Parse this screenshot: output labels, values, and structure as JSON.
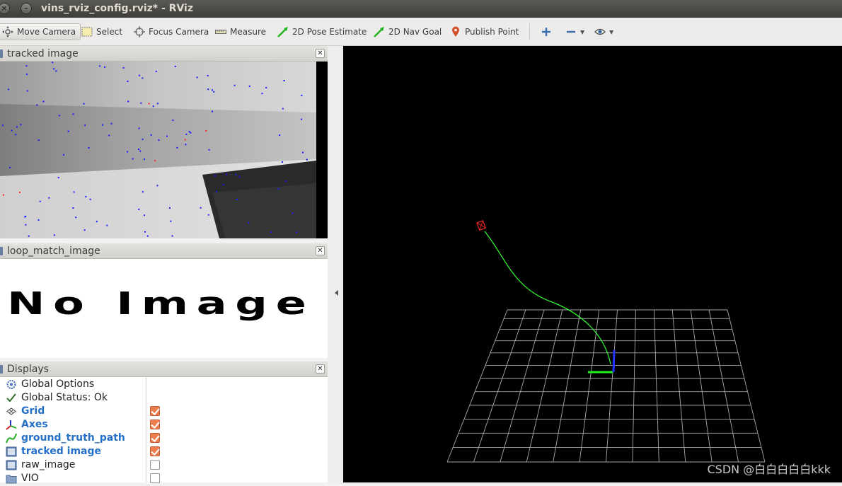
{
  "window": {
    "title": "vins_rviz_config.rviz* - RViz"
  },
  "toolbar": {
    "tools": [
      {
        "label": "Move Camera",
        "icon": "move-camera-icon"
      },
      {
        "label": "Select",
        "icon": "select-icon"
      },
      {
        "label": "Focus Camera",
        "icon": "focus-camera-icon"
      },
      {
        "label": "Measure",
        "icon": "measure-icon"
      },
      {
        "label": "2D Pose Estimate",
        "icon": "pose-estimate-icon"
      },
      {
        "label": "2D Nav Goal",
        "icon": "nav-goal-icon"
      },
      {
        "label": "Publish Point",
        "icon": "publish-point-icon"
      }
    ],
    "active_tool": "Move Camera"
  },
  "panels": {
    "tracked_image": {
      "title": "tracked image"
    },
    "loop_match_image": {
      "title": "loop_match_image",
      "placeholder_text": "No Image"
    },
    "displays": {
      "title": "Displays",
      "items": [
        {
          "label": "Global Options",
          "icon": "gear-icon",
          "checked": null,
          "highlight": false
        },
        {
          "label": "Global Status: Ok",
          "icon": "check-icon",
          "checked": null,
          "highlight": false
        },
        {
          "label": "Grid",
          "icon": "grid-icon",
          "checked": true,
          "highlight": true
        },
        {
          "label": "Axes",
          "icon": "axes-icon",
          "checked": true,
          "highlight": true
        },
        {
          "label": "ground_truth_path",
          "icon": "path-icon",
          "checked": true,
          "highlight": true
        },
        {
          "label": "tracked image",
          "icon": "image-icon",
          "checked": true,
          "highlight": true
        },
        {
          "label": "raw_image",
          "icon": "image-icon",
          "checked": false,
          "highlight": false
        },
        {
          "label": "VIO",
          "icon": "folder-icon",
          "checked": false,
          "highlight": false
        }
      ]
    }
  },
  "viewport": {
    "background": "#000000",
    "grid_color": "#a8a8a8",
    "path_color": "#33ff33",
    "watermark": "CSDN @白白白白白kkk"
  },
  "colors": {
    "accent_check": "#ee7d4f",
    "highlight_text": "#2470c8"
  }
}
